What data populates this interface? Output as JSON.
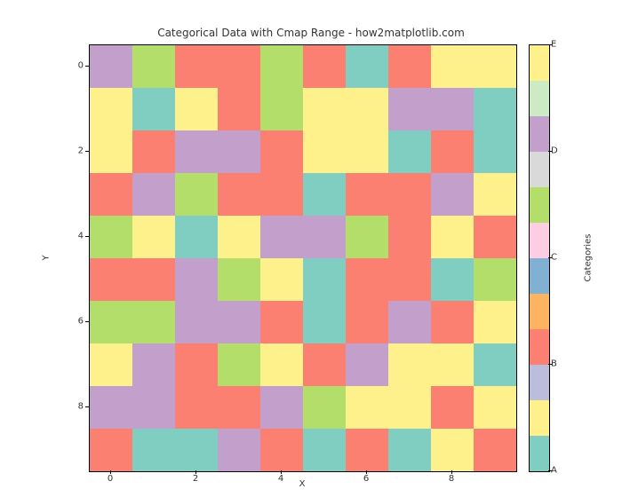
{
  "chart_data": {
    "type": "heatmap",
    "title": "Categorical Data with Cmap Range - how2matplotlib.com",
    "xlabel": "X",
    "ylabel": "Y",
    "xticks": [
      0,
      2,
      4,
      6,
      8
    ],
    "yticks": [
      0,
      2,
      4,
      6,
      8
    ],
    "xlim": [
      -0.5,
      9.5
    ],
    "ylim": [
      9.5,
      -0.5
    ],
    "categories": [
      "A",
      "B",
      "C",
      "D",
      "E"
    ],
    "category_colors": {
      "0": "#80cdc2",
      "1": "#fef08b",
      "2": "#bcbddb",
      "3": "#fb8072",
      "4": "#fcb461",
      "5": "#80b1d3",
      "6": "#fdcde4",
      "7": "#b3de6a",
      "8": "#d9d9d9",
      "9": "#c3a0cb",
      "10": "#ccebc5",
      "11": "#fef08b"
    },
    "grid": [
      [
        9,
        7,
        3,
        3,
        7,
        3,
        0,
        3,
        1,
        1
      ],
      [
        1,
        0,
        1,
        3,
        7,
        1,
        1,
        9,
        9,
        0
      ],
      [
        1,
        3,
        9,
        9,
        3,
        1,
        1,
        0,
        3,
        0
      ],
      [
        3,
        9,
        7,
        3,
        3,
        0,
        3,
        3,
        9,
        1
      ],
      [
        7,
        1,
        0,
        1,
        9,
        9,
        7,
        3,
        1,
        3
      ],
      [
        3,
        3,
        9,
        7,
        1,
        0,
        3,
        3,
        0,
        7
      ],
      [
        7,
        7,
        9,
        9,
        3,
        0,
        3,
        9,
        3,
        1
      ],
      [
        1,
        9,
        3,
        7,
        1,
        3,
        9,
        1,
        1,
        0
      ],
      [
        9,
        9,
        3,
        3,
        9,
        7,
        1,
        1,
        3,
        1
      ],
      [
        3,
        0,
        0,
        9,
        3,
        0,
        3,
        0,
        1,
        3
      ]
    ],
    "colorbar": {
      "label": "Categories",
      "tick_labels": [
        "A",
        "B",
        "C",
        "D",
        "E"
      ],
      "segments": [
        0,
        1,
        2,
        3,
        4,
        5,
        6,
        7,
        8,
        9,
        10,
        11
      ]
    }
  }
}
